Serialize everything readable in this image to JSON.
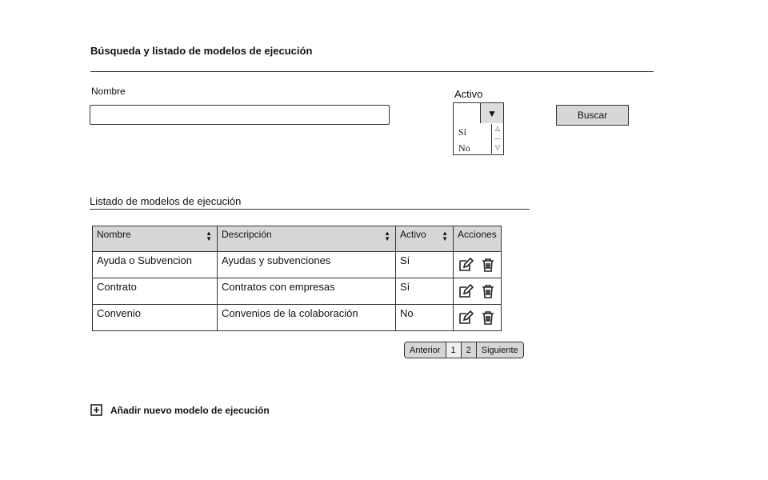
{
  "page": {
    "title": "Búsqueda y listado de modelos de ejecución"
  },
  "search": {
    "name_label": "Nombre",
    "name_value": "",
    "active_label": "Activo",
    "active_selected": "",
    "active_options": [
      "Sí",
      "No"
    ],
    "search_button": "Buscar"
  },
  "listing": {
    "title": "Listado de modelos de ejecución",
    "columns": [
      "Nombre",
      "Descripción",
      "Activo",
      "Acciones"
    ],
    "rows": [
      {
        "nombre": "Ayuda o Subvencion",
        "descripcion": "Ayudas y subvenciones",
        "activo": "Sí"
      },
      {
        "nombre": "Contrato",
        "descripcion": "Contratos con empresas",
        "activo": "Sí"
      },
      {
        "nombre": "Convenio",
        "descripcion": "Convenios de la colaboración",
        "activo": "No"
      }
    ],
    "row_actions": [
      "edit-icon",
      "delete-icon"
    ]
  },
  "pagination": {
    "previous": "Anterior",
    "pages": [
      "1",
      "2"
    ],
    "next": "Siguiente"
  },
  "add": {
    "label": "Añadir nuevo modelo de ejecución",
    "icon": "plus-square-icon"
  }
}
